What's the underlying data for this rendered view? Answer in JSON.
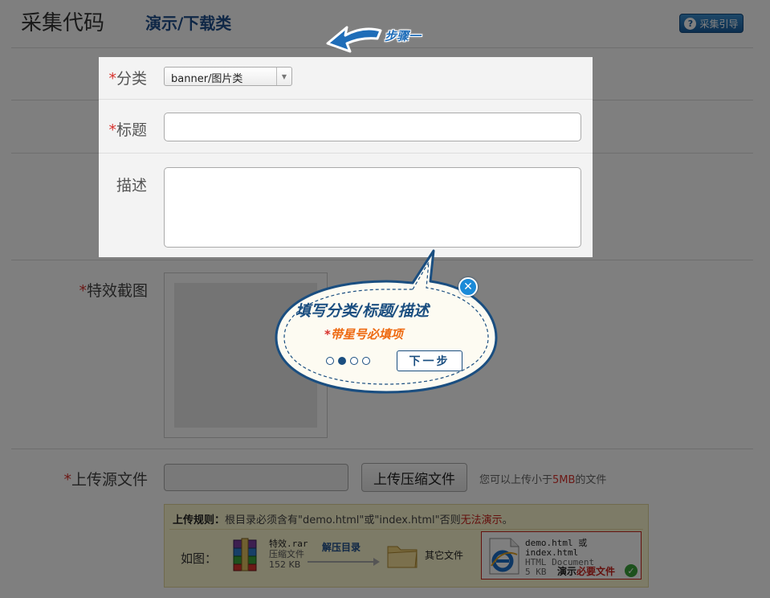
{
  "header": {
    "title": "采集代码",
    "subtitle": "演示/下载类",
    "help_label": "采集引导",
    "help_icon": "question-icon"
  },
  "form": {
    "category": {
      "label": "分类",
      "required": "*",
      "value": "banner/图片类"
    },
    "title": {
      "label": "标题",
      "required": "*",
      "value": ""
    },
    "description": {
      "label": "描述",
      "value": ""
    },
    "screenshot": {
      "label": "特效截图",
      "required": "*"
    },
    "source_file": {
      "label": "上传源文件",
      "required": "*",
      "button_label": "上传压缩文件",
      "hint_prefix": "您可以上传小于",
      "hint_size": "5MB",
      "hint_suffix": "的文件"
    }
  },
  "rules": {
    "heading": "上传规则：",
    "text_a": "根目录必须含有\"demo.html\"或\"index.html\"否则",
    "text_warn": "无法演示",
    "text_end": "。",
    "example_label": "如图：",
    "archive_name": "特效.rar",
    "archive_type": "压缩文件",
    "archive_size": "152 KB",
    "arrow_label": "解压目录",
    "other_files": "其它文件",
    "html_name": "demo.html 或 index.html",
    "html_type": "HTML Document",
    "html_size": "5 KB",
    "must_prefix": "演示",
    "must_highlight": "必要文件"
  },
  "guide": {
    "step_label": "步骤一",
    "bubble_title": "填写分类/标题/描述",
    "bubble_note_star": "*",
    "bubble_note": "带星号必填项",
    "next_label": "下一步",
    "total_steps": 4,
    "current_step": 2
  },
  "colors": {
    "accent_blue": "#1a4e80",
    "required_red": "#d8322d",
    "note_orange": "#ee6a12",
    "overlay": "rgba(0,0,0,0.5)"
  }
}
